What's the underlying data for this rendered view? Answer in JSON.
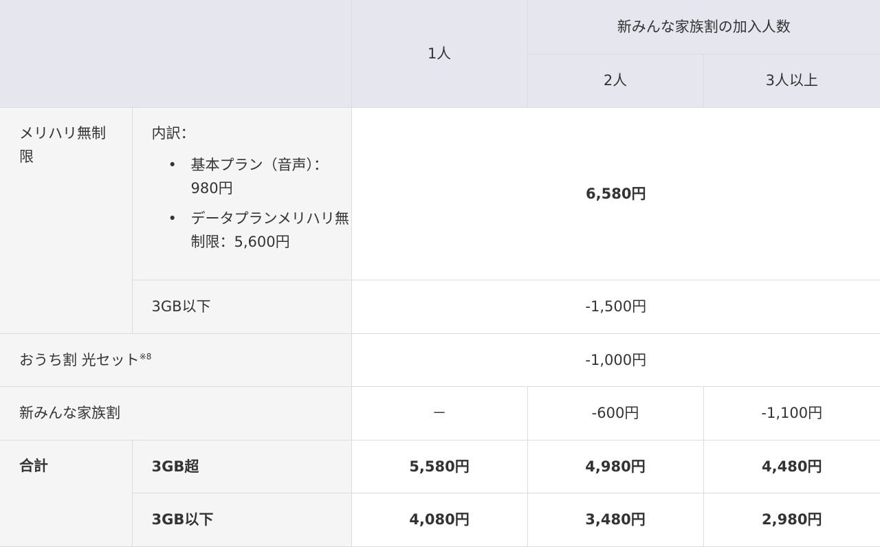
{
  "header": {
    "one_person": "1人",
    "family_group": "新みんな家族割の加入人数",
    "two_people": "2人",
    "three_plus": "3人以上"
  },
  "merihari": {
    "label": "メリハリ無制限",
    "breakdown_title": "内訳：",
    "items": [
      "基本プラン（音声）：980円",
      "データプランメリハリ無制限：5,600円"
    ],
    "price": "6,580円",
    "under3gb_label": "3GB以下",
    "under3gb_value": "-1,500円"
  },
  "home": {
    "label": "おうち割 光セット",
    "note": "※8",
    "value": "-1,000円"
  },
  "family": {
    "label": "新みんな家族割",
    "v1": "－",
    "v2": "-600円",
    "v3": "-1,100円"
  },
  "total": {
    "label": "合計",
    "over_label": "3GB超",
    "over": [
      "5,580円",
      "4,980円",
      "4,480円"
    ],
    "under_label": "3GB以下",
    "under": [
      "4,080円",
      "3,480円",
      "2,980円"
    ]
  }
}
